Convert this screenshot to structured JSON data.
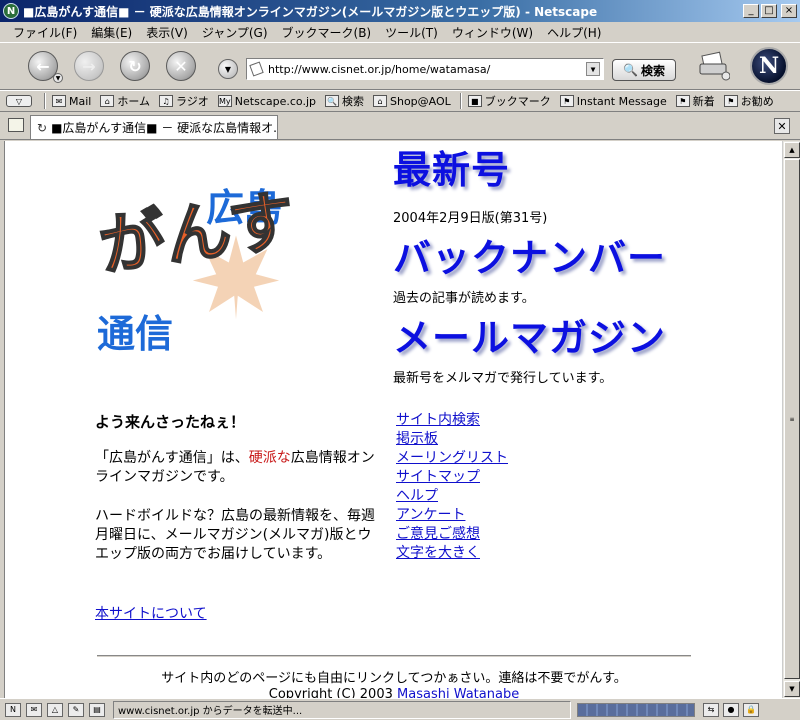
{
  "window": {
    "title": "■広島がんす通信■ － 硬派な広島情報オンラインマガジン(メールマガジン版とウエップ版) - Netscape",
    "app_icon": "N",
    "controls": {
      "minimize": "_",
      "maximize": "□",
      "close": "×"
    }
  },
  "menu": {
    "items": [
      "ファイル(F)",
      "編集(E)",
      "表示(V)",
      "ジャンプ(G)",
      "ブックマーク(B)",
      "ツール(T)",
      "ウィンドウ(W)",
      "ヘルプ(H)"
    ]
  },
  "navbar": {
    "url": "http://www.cisnet.or.jp/home/watamasa/",
    "search_label": "検索",
    "logo_letter": "N"
  },
  "personal_toolbar": {
    "items": [
      "Mail",
      "ホーム",
      "ラジオ",
      "Netscape.co.jp",
      "検索",
      "Shop@AOL",
      "ブックマーク",
      "Instant Message",
      "新着",
      "お勧め"
    ]
  },
  "tab": {
    "label": "■広島がんす通信■ － 硬派な広島情報オ..."
  },
  "page": {
    "logo": {
      "main": "がんす",
      "top": "広島",
      "bottom": "通信"
    },
    "latest": {
      "title": "最新号",
      "desc": "2004年2月9日版(第31号)"
    },
    "back": {
      "title": "バックナンバー",
      "desc": "過去の記事が読めます。"
    },
    "mailmag": {
      "title": "メールマガジン",
      "desc": "最新号をメルマガで発行しています。"
    },
    "welcome": "よう来んさったねぇ！",
    "intro_prefix": "「広島がんす通信」は、",
    "intro_red": "硬派な",
    "intro_suffix": "広島情報オンラインマガジンです。",
    "para2": "ハードボイルドな？広島の最新情報を、毎週月曜日に、メールマガジン(メルマガ)版とウエップ版の両方でお届けしています。",
    "about_link": "本サイトについて",
    "links": [
      "サイト内検索",
      "掲示板",
      "メーリングリスト",
      "サイトマップ",
      "ヘルプ",
      "アンケート",
      "ご意見ご感想",
      "文字を大きく"
    ],
    "footer_note": "サイト内のどのページにも自由にリンクしてつかぁさい。連絡は不要でがんす。",
    "copyright_prefix": "Copyright (C) 2003 ",
    "copyright_link": "Masashi Watanabe"
  },
  "status": {
    "text": "www.cisnet.or.jp からデータを転送中...",
    "progress": 1.0
  },
  "colors": {
    "heading_blue": "#0c10e0",
    "link": "#1010cc",
    "accent_red": "#c81818",
    "logo_orange": "#e86028",
    "logo_blue": "#1d6ad8"
  }
}
